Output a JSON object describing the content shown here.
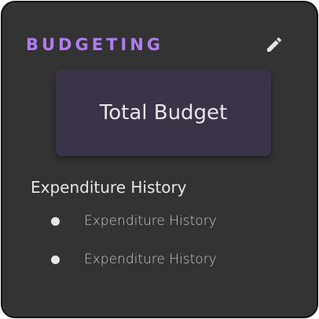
{
  "card": {
    "title": "BUDGETING",
    "edit_icon": "pencil-icon",
    "accent_color": "#b07cf0",
    "background_color": "#333333"
  },
  "budget_tile": {
    "label": "Total Budget",
    "color": "#3b3347"
  },
  "history": {
    "title": "Expenditure History",
    "items": [
      {
        "label": "Expenditure History",
        "icon": "bullet"
      },
      {
        "label": "Expenditure History",
        "icon": "bullet"
      }
    ]
  }
}
